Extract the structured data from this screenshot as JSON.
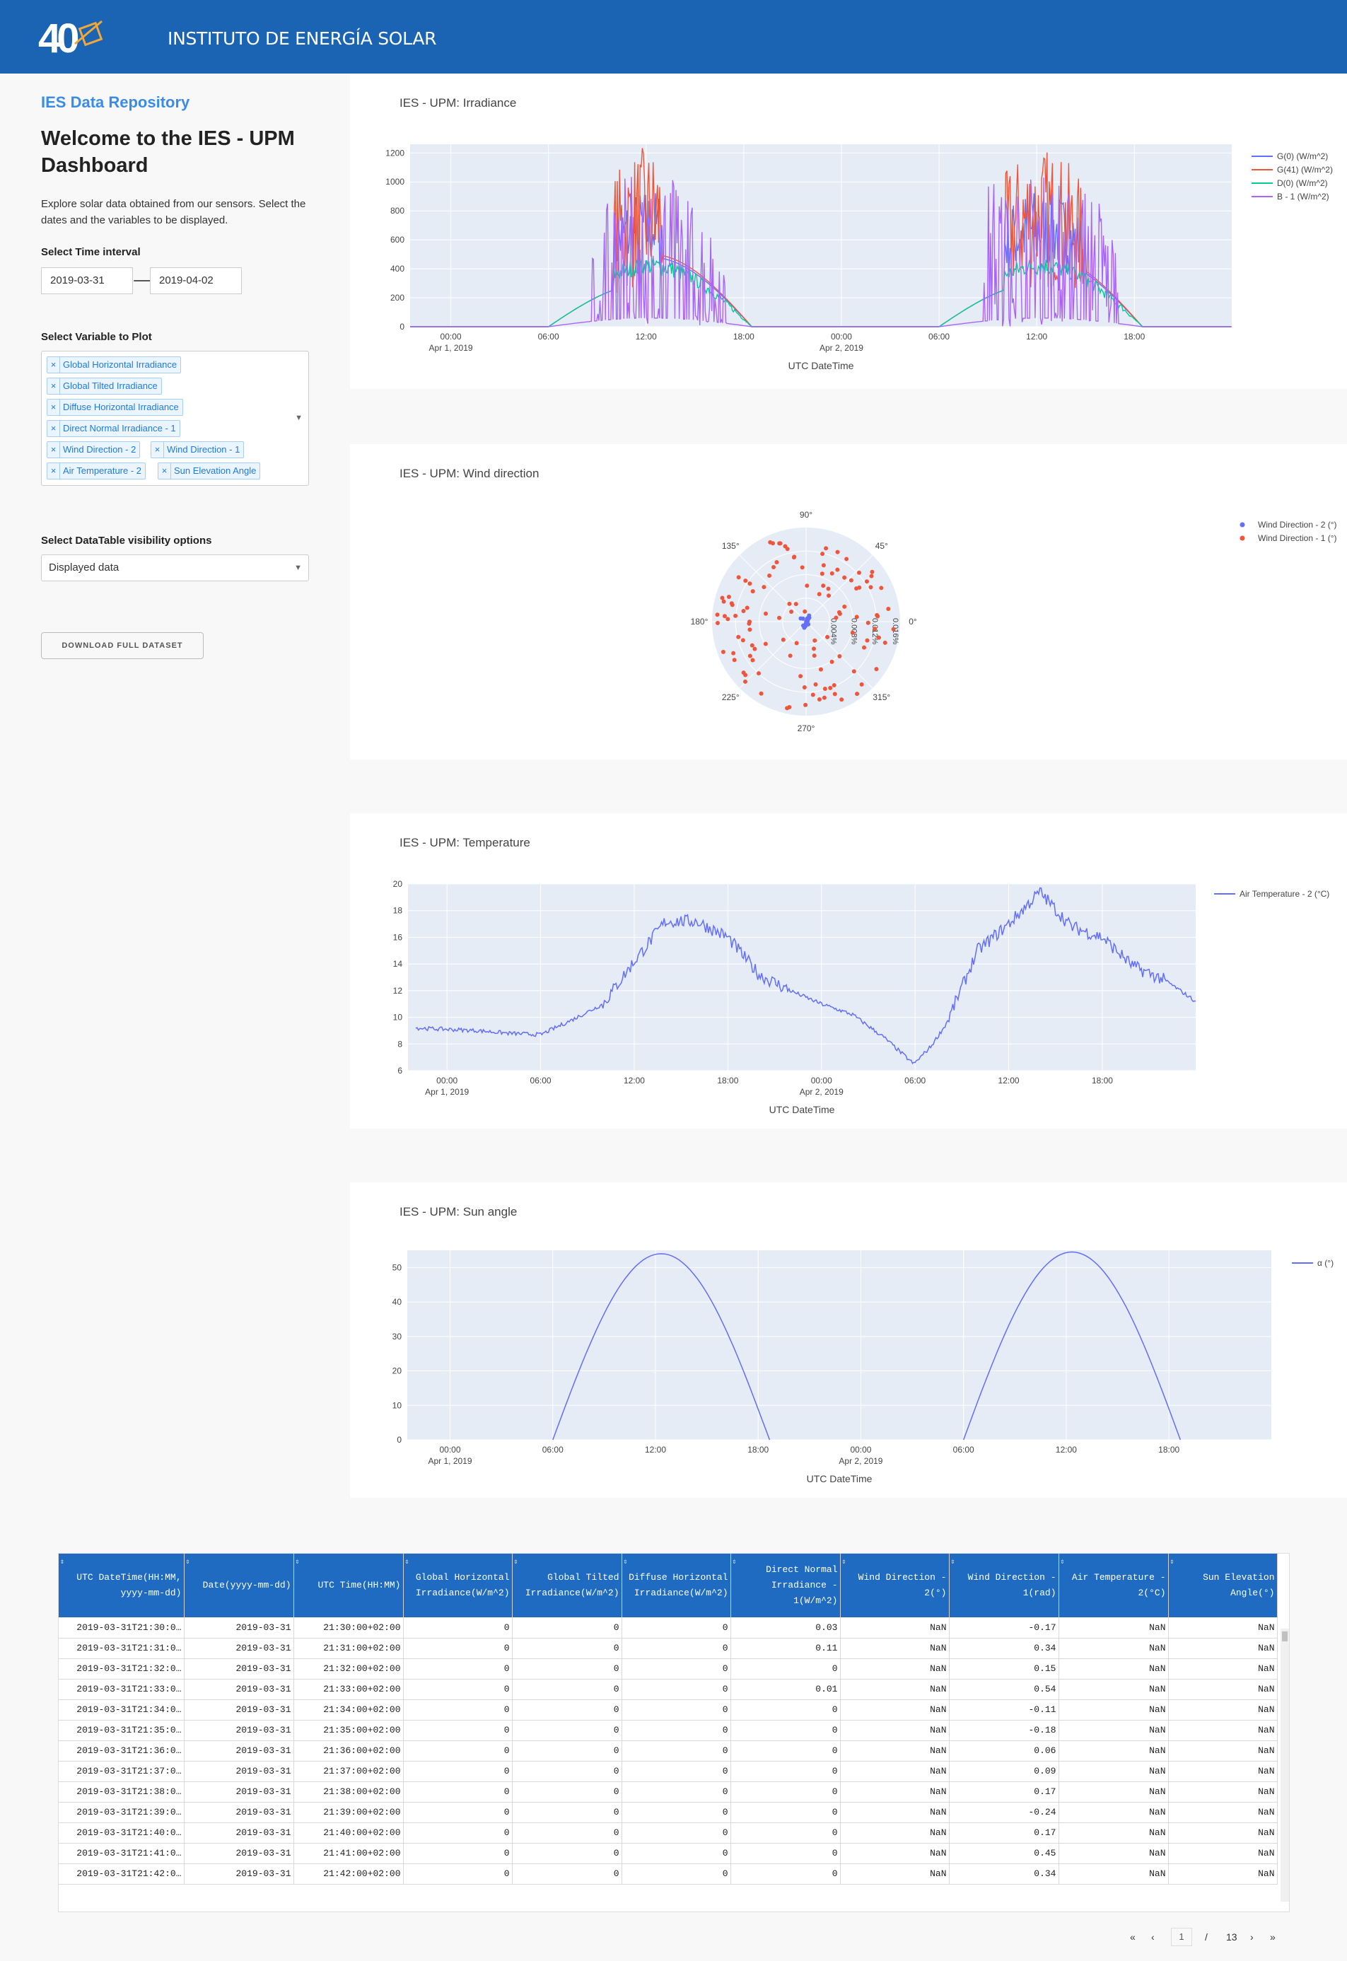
{
  "header": {
    "title": "INSTITUTO DE ENERGÍA SOLAR",
    "logo_text": "40"
  },
  "sidebar": {
    "repo_title": "IES Data Repository",
    "welcome": "Welcome to the IES - UPM Dashboard",
    "intro": "Explore solar data obtained from our sensors. Select the dates and the variables to be displayed.",
    "time_label": "Select Time interval",
    "date_start": "2019-03-31",
    "date_end": "2019-04-02",
    "var_label": "Select Variable to Plot",
    "variables": [
      "Global Horizontal Irradiance",
      "Global Tilted Irradiance",
      "Diffuse Horizontal Irradiance",
      "Direct Normal Irradiance - 1",
      "Wind Direction - 2",
      "Wind Direction - 1",
      "Air Temperature - 2",
      "Sun Elevation Angle"
    ],
    "dt_label": "Select DataTable visibility options",
    "dt_value": "Displayed data",
    "download": "DOWNLOAD FULL DATASET"
  },
  "panels": {
    "irradiance_title": "IES - UPM: Irradiance",
    "wind_title": "IES - UPM: Wind direction",
    "temperature_title": "IES - UPM: Temperature",
    "sun_title": "IES - UPM: Sun angle"
  },
  "chart_data": [
    {
      "type": "line",
      "title": "IES - UPM: Irradiance",
      "xlabel": "UTC DateTime",
      "ylabel": "",
      "x_range": [
        "2019-03-31 21:30",
        "2019-04-02 23:59"
      ],
      "ylim": [
        0,
        1260
      ],
      "yticks": [
        0,
        200,
        400,
        600,
        800,
        1000,
        1200
      ],
      "xticks": [
        "00:00",
        "06:00",
        "12:00",
        "18:00",
        "00:00",
        "06:00",
        "12:00",
        "18:00"
      ],
      "xtick_dates": [
        "Apr 1, 2019",
        "",
        "",
        "",
        "Apr 2, 2019",
        "",
        "",
        ""
      ],
      "legend_position": "top-right",
      "colors": {
        "G0": "#636efa",
        "G41": "#ef553b",
        "D0": "#00cc96",
        "B1": "#ab63fa"
      },
      "series": [
        {
          "name": "G(0) (W/m^2)",
          "key": "G0",
          "approx_peak": [
            940,
            860
          ]
        },
        {
          "name": "G(41) (W/m^2)",
          "key": "G41",
          "approx_peak": [
            1220,
            1240
          ]
        },
        {
          "name": "D(0) (W/m^2)",
          "key": "D0",
          "approx_peak": [
            460,
            440
          ]
        },
        {
          "name": "B - 1 (W/m^2)",
          "key": "B1",
          "approx_peak": [
            700,
            1050
          ]
        }
      ]
    },
    {
      "type": "scatter",
      "title": "IES - UPM: Wind direction",
      "polar": true,
      "angular_ticks": [
        "90°",
        "45°",
        "0°",
        "315°",
        "270°",
        "225°",
        "180°",
        "135°"
      ],
      "radial_ticks": [
        "0.004%",
        "0.008%",
        "0.012%",
        "0.016%"
      ],
      "legend_position": "top-right",
      "series": [
        {
          "name": "Wind Direction - 2 (°)",
          "color": "#636efa"
        },
        {
          "name": "Wind Direction - 1 (°)",
          "color": "#ef553b"
        }
      ]
    },
    {
      "type": "line",
      "title": "IES - UPM: Temperature",
      "xlabel": "UTC DateTime",
      "ylim": [
        6,
        20
      ],
      "yticks": [
        6,
        8,
        10,
        12,
        14,
        16,
        18,
        20
      ],
      "xticks": [
        "00:00",
        "06:00",
        "12:00",
        "18:00",
        "00:00",
        "06:00",
        "12:00",
        "18:00"
      ],
      "xtick_dates": [
        "Apr 1, 2019",
        "",
        "",
        "",
        "Apr 2, 2019",
        "",
        "",
        ""
      ],
      "legend_position": "top-right",
      "series": [
        {
          "name": "Air Temperature - 2 (°C)",
          "color": "#636efa",
          "points": [
            [
              "2019-03-31 22:00",
              9.2
            ],
            [
              "2019-04-01 00:00",
              9.1
            ],
            [
              "2019-04-01 02:00",
              9.0
            ],
            [
              "2019-04-01 04:00",
              8.8
            ],
            [
              "2019-04-01 06:00",
              8.7
            ],
            [
              "2019-04-01 08:00",
              9.8
            ],
            [
              "2019-04-01 10:00",
              11.0
            ],
            [
              "2019-04-01 12:00",
              14.2
            ],
            [
              "2019-04-01 14:00",
              17.2
            ],
            [
              "2019-04-01 16:00",
              17.2
            ],
            [
              "2019-04-01 18:00",
              16.0
            ],
            [
              "2019-04-01 20:00",
              13.2
            ],
            [
              "2019-04-01 22:00",
              12.0
            ],
            [
              "2019-04-02 00:00",
              11.0
            ],
            [
              "2019-04-02 02:00",
              10.2
            ],
            [
              "2019-04-02 04:00",
              8.5
            ],
            [
              "2019-04-02 05:55",
              6.5
            ],
            [
              "2019-04-02 07:00",
              7.8
            ],
            [
              "2019-04-02 08:00",
              9.5
            ],
            [
              "2019-04-02 10:00",
              15.0
            ],
            [
              "2019-04-02 12:00",
              17.0
            ],
            [
              "2019-04-02 14:00",
              19.4
            ],
            [
              "2019-04-02 16:00",
              16.8
            ],
            [
              "2019-04-02 18:00",
              16.0
            ],
            [
              "2019-04-02 20:00",
              13.8
            ],
            [
              "2019-04-02 22:00",
              12.8
            ],
            [
              "2019-04-02 23:59",
              11.2
            ]
          ]
        }
      ]
    },
    {
      "type": "line",
      "title": "IES - UPM: Sun angle",
      "xlabel": "UTC DateTime",
      "ylim": [
        0,
        55
      ],
      "yticks": [
        0,
        10,
        20,
        30,
        40,
        50
      ],
      "xticks": [
        "00:00",
        "06:00",
        "12:00",
        "18:00",
        "00:00",
        "06:00",
        "12:00",
        "18:00"
      ],
      "xtick_dates": [
        "Apr 1, 2019",
        "",
        "",
        "",
        "Apr 2, 2019",
        "",
        "",
        ""
      ],
      "legend_position": "top-right",
      "series": [
        {
          "name": "α (°)",
          "color": "#636efa",
          "points": [
            [
              "2019-04-01 06:00",
              0
            ],
            [
              "2019-04-01 09:00",
              34
            ],
            [
              "2019-04-01 12:00",
              54
            ],
            [
              "2019-04-01 15:00",
              34
            ],
            [
              "2019-04-01 18:40",
              0
            ],
            [
              "2019-04-02 06:00",
              0
            ],
            [
              "2019-04-02 09:00",
              34
            ],
            [
              "2019-04-02 12:00",
              54.5
            ],
            [
              "2019-04-02 15:00",
              34
            ],
            [
              "2019-04-02 18:40",
              0
            ]
          ]
        }
      ]
    }
  ],
  "table": {
    "columns": [
      "UTC DateTime(HH:MM, yyyy-mm-dd)",
      "Date(yyyy-mm-dd)",
      "UTC Time(HH:MM)",
      "Global Horizontal Irradiance(W/m^2)",
      "Global Tilted Irradiance(W/m^2)",
      "Diffuse Horizontal Irradiance(W/m^2)",
      "Direct Normal Irradiance - 1(W/m^2)",
      "Wind Direction - 2(°)",
      "Wind Direction - 1(rad)",
      "Air Temperature - 2(°C)",
      "Sun Elevation Angle(°)"
    ],
    "rows": [
      [
        "2019-03-31T21:30:0…",
        "2019-03-31",
        "21:30:00+02:00",
        "0",
        "0",
        "0",
        "0.03",
        "NaN",
        "-0.17",
        "NaN",
        "NaN"
      ],
      [
        "2019-03-31T21:31:0…",
        "2019-03-31",
        "21:31:00+02:00",
        "0",
        "0",
        "0",
        "0.11",
        "NaN",
        "0.34",
        "NaN",
        "NaN"
      ],
      [
        "2019-03-31T21:32:0…",
        "2019-03-31",
        "21:32:00+02:00",
        "0",
        "0",
        "0",
        "0",
        "NaN",
        "0.15",
        "NaN",
        "NaN"
      ],
      [
        "2019-03-31T21:33:0…",
        "2019-03-31",
        "21:33:00+02:00",
        "0",
        "0",
        "0",
        "0.01",
        "NaN",
        "0.54",
        "NaN",
        "NaN"
      ],
      [
        "2019-03-31T21:34:0…",
        "2019-03-31",
        "21:34:00+02:00",
        "0",
        "0",
        "0",
        "0",
        "NaN",
        "-0.11",
        "NaN",
        "NaN"
      ],
      [
        "2019-03-31T21:35:0…",
        "2019-03-31",
        "21:35:00+02:00",
        "0",
        "0",
        "0",
        "0",
        "NaN",
        "-0.18",
        "NaN",
        "NaN"
      ],
      [
        "2019-03-31T21:36:0…",
        "2019-03-31",
        "21:36:00+02:00",
        "0",
        "0",
        "0",
        "0",
        "NaN",
        "0.06",
        "NaN",
        "NaN"
      ],
      [
        "2019-03-31T21:37:0…",
        "2019-03-31",
        "21:37:00+02:00",
        "0",
        "0",
        "0",
        "0",
        "NaN",
        "0.09",
        "NaN",
        "NaN"
      ],
      [
        "2019-03-31T21:38:0…",
        "2019-03-31",
        "21:38:00+02:00",
        "0",
        "0",
        "0",
        "0",
        "NaN",
        "0.17",
        "NaN",
        "NaN"
      ],
      [
        "2019-03-31T21:39:0…",
        "2019-03-31",
        "21:39:00+02:00",
        "0",
        "0",
        "0",
        "0",
        "NaN",
        "-0.24",
        "NaN",
        "NaN"
      ],
      [
        "2019-03-31T21:40:0…",
        "2019-03-31",
        "21:40:00+02:00",
        "0",
        "0",
        "0",
        "0",
        "NaN",
        "0.17",
        "NaN",
        "NaN"
      ],
      [
        "2019-03-31T21:41:0…",
        "2019-03-31",
        "21:41:00+02:00",
        "0",
        "0",
        "0",
        "0",
        "NaN",
        "0.45",
        "NaN",
        "NaN"
      ],
      [
        "2019-03-31T21:42:0…",
        "2019-03-31",
        "21:42:00+02:00",
        "0",
        "0",
        "0",
        "0",
        "NaN",
        "0.34",
        "NaN",
        "NaN"
      ]
    ]
  },
  "pager": {
    "first": "«",
    "prev": "‹",
    "current": "1",
    "sep": "/",
    "total": "13",
    "next": "›",
    "last": "»"
  }
}
